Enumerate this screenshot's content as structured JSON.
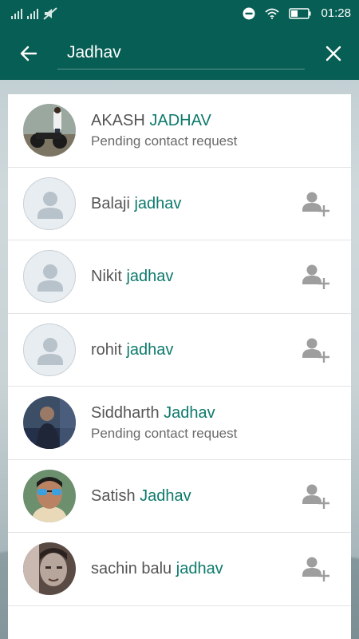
{
  "status": {
    "time": "01:28"
  },
  "search": {
    "query": "Jadhav"
  },
  "results": [
    {
      "prefix": "AKASH ",
      "match": "JADHAV",
      "subtitle": "Pending contact request",
      "avatar": "photo-bike",
      "addable": false
    },
    {
      "prefix": "Balaji ",
      "match": "jadhav",
      "subtitle": "",
      "avatar": "default-person-icon",
      "addable": true
    },
    {
      "prefix": "Nikit ",
      "match": "jadhav",
      "subtitle": "",
      "avatar": "default-person-icon",
      "addable": true
    },
    {
      "prefix": "rohit ",
      "match": "jadhav",
      "subtitle": "",
      "avatar": "default-person-icon",
      "addable": true
    },
    {
      "prefix": "Siddharth ",
      "match": "Jadhav",
      "subtitle": "Pending contact request",
      "avatar": "photo-dark",
      "addable": false
    },
    {
      "prefix": "Satish ",
      "match": "Jadhav",
      "subtitle": "",
      "avatar": "photo-sunglasses",
      "addable": true
    },
    {
      "prefix": "sachin balu ",
      "match": "jadhav",
      "subtitle": "",
      "avatar": "photo-selfie",
      "addable": true
    }
  ],
  "colors": {
    "header": "#075e54",
    "highlight": "#0d7a6c",
    "icon": "#9e9e9e"
  }
}
